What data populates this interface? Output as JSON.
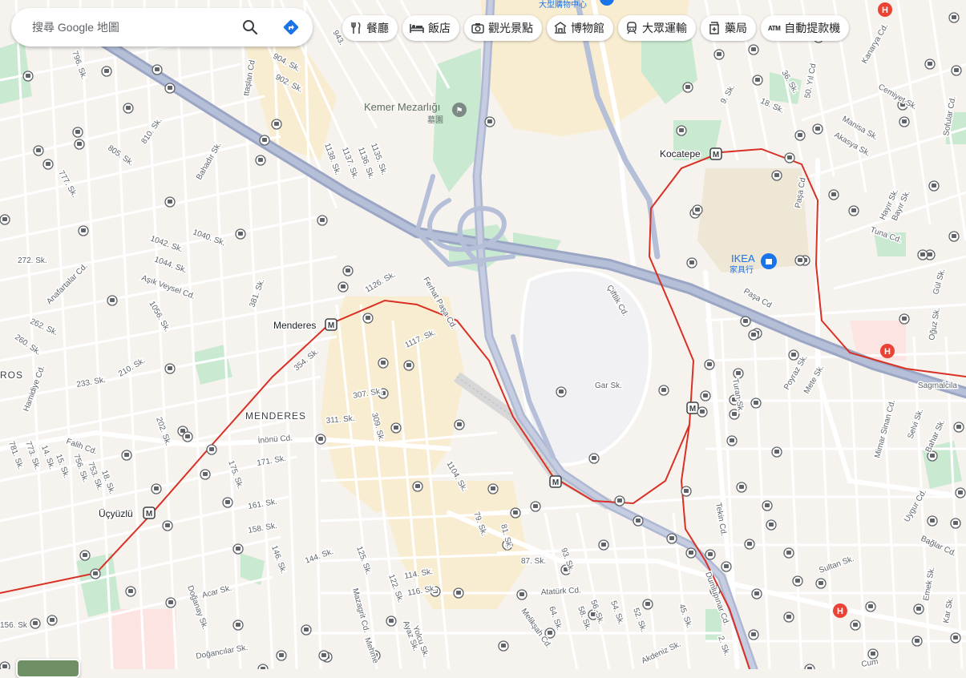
{
  "search": {
    "placeholder": "搜尋 Google 地圖"
  },
  "chips": [
    {
      "label": "餐廳",
      "icon": "restaurant-icon"
    },
    {
      "label": "飯店",
      "icon": "hotel-icon"
    },
    {
      "label": "觀光景點",
      "icon": "camera-icon"
    },
    {
      "label": "博物館",
      "icon": "museum-icon"
    },
    {
      "label": "大眾運輸",
      "icon": "transit-icon"
    },
    {
      "label": "藥局",
      "icon": "pharmacy-icon"
    },
    {
      "label": "自動提款機",
      "icon": "atm-icon",
      "glyph": "ATM"
    }
  ],
  "map": {
    "places": {
      "top_mall": "大型購物中心",
      "cemetery_name": "Kemer Mezarlığı",
      "cemetery_type": "墓園",
      "ikea_name": "IKEA",
      "ikea_type": "家具行",
      "district_menderes": "MENDERES",
      "district_ros": "ROS"
    },
    "stations": {
      "kocatepe": "Kocatepe",
      "menderes": "Menderes",
      "ucyuzlu": "Üçyüzlü"
    },
    "streets": {
      "s904": "904. Sk.",
      "s902": "902. Sk.",
      "s796": "796. Sk.",
      "s805": "805. Sk.",
      "s810": "810. Sk.",
      "s777": "777. Sk.",
      "bahadir": "Bahadır Sk.",
      "s1138": "1138. Sk.",
      "s1137": "1137. Sk.",
      "s1136": "1136. Sk.",
      "s1135": "1135. Sk.",
      "s1040": "1040. Sk.",
      "s1042": "1042. Sk.",
      "s1044": "1044. Sk.",
      "asik": "Aşık Veysel Cd.",
      "s1056": "1056. Sk.",
      "anafartalar": "Anafartalar Cd.",
      "s272": "272. Sk.",
      "s262": "262. Sk.",
      "s260": "260. Sk.",
      "s233": "233. Sk.",
      "s210": "210. Sk.",
      "s381": "381. Sk.",
      "s1126": "1126. Sk.",
      "fethat": "Ferhat Paşa Cd.",
      "s1117": "1117. Sk.",
      "s354": "354. Sk.",
      "s307": "307. Sk.",
      "s311": "311. Sk.",
      "s309": "309. Sk.",
      "hamidiye": "Hamidiye Cd.",
      "s202": "202. Sk.",
      "inonu": "İnönü Cd.",
      "s171": "171. Sk.",
      "s175": "175. Sk.",
      "falih": "Falih Cd.",
      "s781": "781. Sk.",
      "s773": "773. Sk.",
      "s14": "14. Sk.",
      "s15": "15. Sk.",
      "s756": "756. Sk.",
      "s753": "753. Sk.",
      "s18": "18. Sk.",
      "s161": "161. Sk.",
      "s158": "158. Sk.",
      "s146": "146. Sk.",
      "s144": "144. Sk.",
      "s125": "125. Sk.",
      "s122": "122. Sk.",
      "mazagrit": "Mazagrit Cd.",
      "s114": "114. Sk.",
      "s116": "116. Sk.",
      "yolcu": "Yolcu Sk.",
      "ayaz": "Ayaz Sk.",
      "mehmet": "Mehme",
      "acar": "Acar Sk.",
      "dogancilar": "Doğancılar Sk.",
      "doganay": "Doğanay Sk.",
      "s156": "156. Sk",
      "s1104": "1104. Sk.",
      "s79": "79. Sk.",
      "s81": "81. Sk.",
      "s87": "87. Sk.",
      "s93": "93. Sk.",
      "ataturk": "Atatürk Cd.",
      "meliksah": "Melikşah Cd.",
      "s64": "64. Sk.",
      "s56": "56. Sk.",
      "s58": "58. Sk.",
      "s54": "54. Sk.",
      "s52": "52. Sk.",
      "s45": "45. Sk.",
      "s2": "2. Sk.",
      "akdeniz": "Akdeniz Sk.",
      "dumlupinar": "Dumlupınar Cd.",
      "ciftlik": "Çiftlik Cd.",
      "gar": "Gar Sk.",
      "pasa_cd": "Paşa Cd",
      "pasa_cd2": "Paşa Cd",
      "turan": "Turan Sk.",
      "poyraz": "Poyraz Sk.",
      "mete": "Mete Sk.",
      "tekin": "Tekin Cd.",
      "mimar": "Mimar Sinan Cd.",
      "selvi": "Selvi Sk.",
      "bahar": "Bahar Sk.",
      "uygur": "Uygur Cd.",
      "baglar": "Bağlar Cd.",
      "sultan": "Sultan Sk.",
      "emek": "Emek Sk.",
      "kar": "Kar Sk.",
      "cum": "Cum",
      "tuna": "Tuna Cd.",
      "hayir": "Hayır Sk.",
      "bayir": "Bayır Sk.",
      "gul": "Gül Sk.",
      "oguz": "Oğuz Sk.",
      "sagmalcilar": "Sagmalcila",
      "kanarya": "Kanarya Cd.",
      "cemiyet": "Cemiyet Sk.",
      "manisa": "Manisa Sk.",
      "akasya": "Akasya Sk.",
      "yil50": "50. Yıl Cd",
      "s36": "36. Sk.",
      "s18b": "18. Sk.",
      "s9": "9. Sk.",
      "sofular": "Sofular Cd.",
      "s943": "943.",
      "tastalan": "ttaşlan Cd"
    }
  },
  "colors": {
    "background": "#f6f3ef",
    "road": "#ffffff",
    "highway": "#9aa6c4",
    "green": "#c9ead1",
    "metro": "#d93025",
    "hospital": "#ea4335",
    "directions": "#1a73e8"
  }
}
